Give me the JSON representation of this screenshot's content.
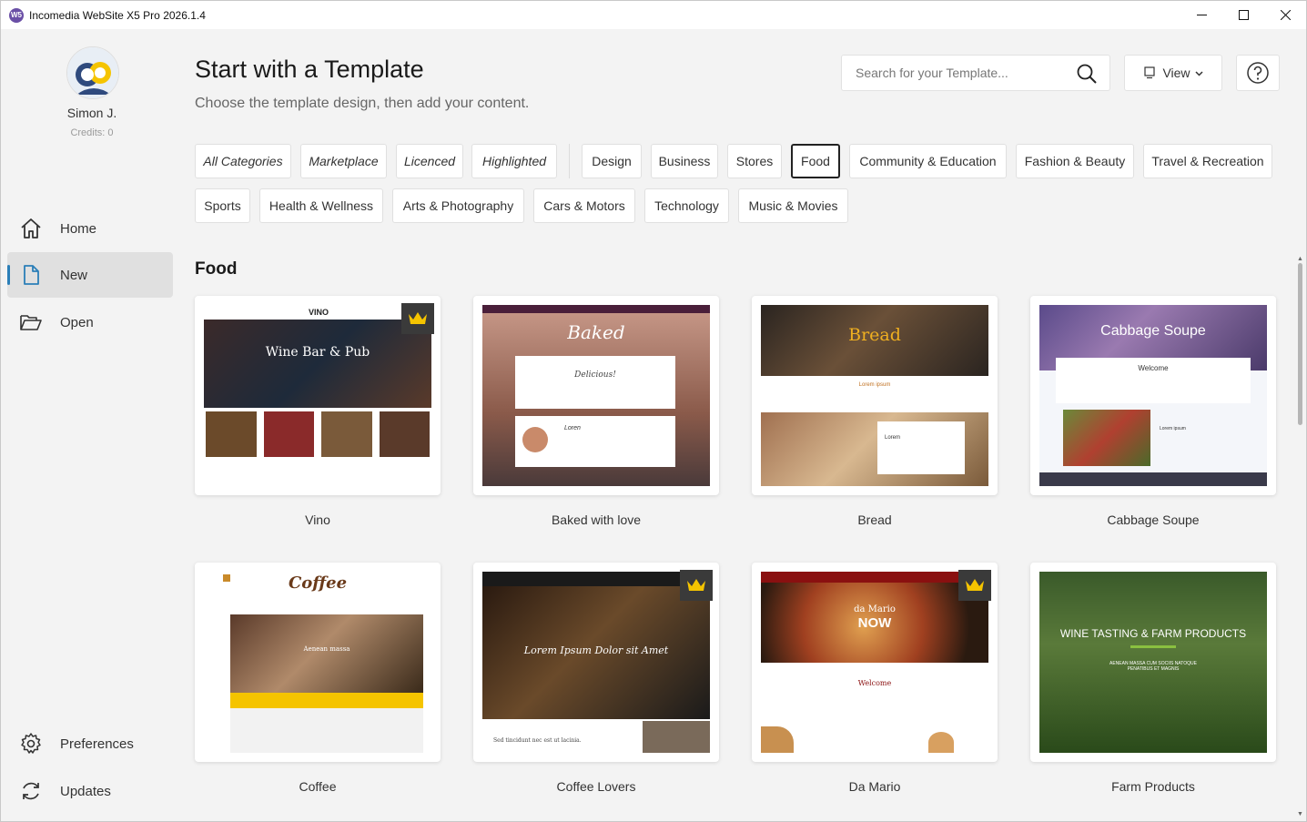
{
  "window": {
    "title": "Incomedia WebSite X5 Pro 2026.1.4",
    "app_icon_text": "W5",
    "minimize_icon": "minimize-icon",
    "maximize_icon": "maximize-icon",
    "close_icon": "close-icon"
  },
  "user": {
    "name": "Simon J.",
    "credits": "Credits: 0"
  },
  "nav": {
    "home": "Home",
    "new": "New",
    "open": "Open",
    "preferences": "Preferences",
    "updates": "Updates"
  },
  "header": {
    "title": "Start with a Template",
    "subtitle": "Choose the template design, then add your content.",
    "search_placeholder": "Search for your Template...",
    "view_label": "View"
  },
  "categories": {
    "all": "All Categories",
    "marketplace": "Marketplace",
    "licenced": "Licenced",
    "highlighted": "Highlighted",
    "design": "Design",
    "business": "Business",
    "stores": "Stores",
    "food": "Food",
    "community": "Community & Education",
    "fashion": "Fashion & Beauty",
    "travel": "Travel & Recreation",
    "sports": "Sports",
    "health": "Health & Wellness",
    "arts": "Arts & Photography",
    "cars": "Cars & Motors",
    "technology": "Technology",
    "music": "Music & Movies",
    "selected": "Food"
  },
  "section": {
    "title": "Food"
  },
  "templates": [
    {
      "name": "Vino",
      "premium": true,
      "thumb_text": "Wine Bar & Pub",
      "brand": "VINO"
    },
    {
      "name": "Baked with love",
      "premium": false,
      "thumb_text": "Baked",
      "sub": "Delicious!",
      "extra": "Loren"
    },
    {
      "name": "Bread",
      "premium": false,
      "thumb_text": "Bread",
      "sub": "Lorem ipsum",
      "extra": "Lorem"
    },
    {
      "name": "Cabbage Soupe",
      "premium": false,
      "thumb_text": "Cabbage Soupe",
      "sub": "Welcome",
      "extra": "Lorem ipsum"
    },
    {
      "name": "Coffee",
      "premium": false,
      "thumb_text": "Coffee",
      "sub": "Aenean massa"
    },
    {
      "name": "Coffee Lovers",
      "premium": true,
      "thumb_text": "Lorem Ipsum Dolor sit Amet",
      "sub": "Sed tincidunt nec est ut lacinia."
    },
    {
      "name": "Da Mario",
      "premium": true,
      "thumb_text": "NOW",
      "brand": "da Mario",
      "sub": "Welcome"
    },
    {
      "name": "Farm Products",
      "premium": false,
      "thumb_text": "WINE TASTING & FARM PRODUCTS",
      "sub": "AENEAN MASSA CUM SOCIIS NATOQUE PENATIBUS ET MAGNIS"
    }
  ],
  "colors": {
    "accent": "#2b7fb8",
    "crown": "#f5c400",
    "selected_border": "#222222"
  }
}
